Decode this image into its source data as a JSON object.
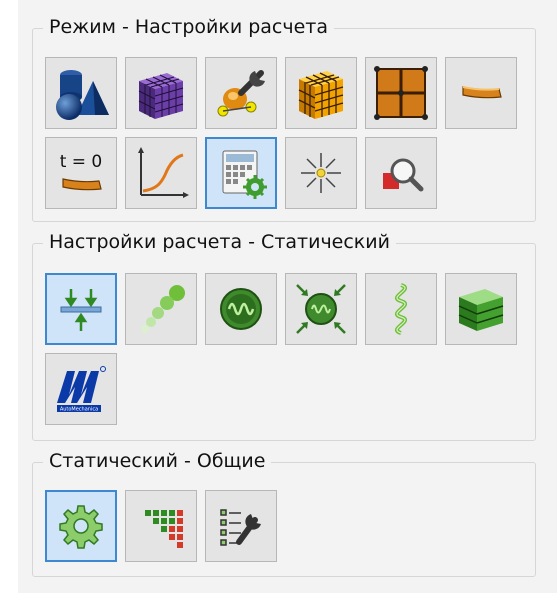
{
  "groups": {
    "mode": {
      "title": "Режим - Настройки расчета",
      "buttons": [
        {
          "icon": "geometry-primitives-icon",
          "selected": false
        },
        {
          "icon": "mesh-cube-icon",
          "selected": false
        },
        {
          "icon": "tools-model-icon",
          "selected": false
        },
        {
          "icon": "material-cube-icon",
          "selected": false
        },
        {
          "icon": "grid-frame-icon",
          "selected": false
        },
        {
          "icon": "beam-element-icon",
          "selected": false
        },
        {
          "icon": "initial-state-icon",
          "label": "t = 0",
          "selected": false
        },
        {
          "icon": "curve-graph-icon",
          "selected": false
        },
        {
          "icon": "calculation-settings-icon",
          "selected": true
        },
        {
          "icon": "sparkle-icon",
          "selected": false
        },
        {
          "icon": "magnifier-results-icon",
          "selected": false
        }
      ]
    },
    "calc": {
      "title": "Настройки расчета - Статический",
      "buttons": [
        {
          "icon": "loads-supports-icon",
          "selected": true
        },
        {
          "icon": "chain-links-icon",
          "selected": false
        },
        {
          "icon": "oscillation-icon",
          "selected": false
        },
        {
          "icon": "oscillation-compression-icon",
          "selected": false
        },
        {
          "icon": "spiral-spring-icon",
          "selected": false
        },
        {
          "icon": "layered-box-icon",
          "selected": false
        },
        {
          "icon": "automechanics-logo-icon",
          "label": "AutoMechanica",
          "selected": false
        }
      ]
    },
    "general": {
      "title": "Статический - Общие",
      "buttons": [
        {
          "icon": "gear-icon",
          "selected": true
        },
        {
          "icon": "matrix-grid-icon",
          "selected": false
        },
        {
          "icon": "list-wrench-icon",
          "selected": false
        }
      ]
    }
  },
  "colors": {
    "selected_border": "#3d88cf",
    "selected_fill": "#cfe4f8",
    "button_fill": "#e4e4e4"
  }
}
